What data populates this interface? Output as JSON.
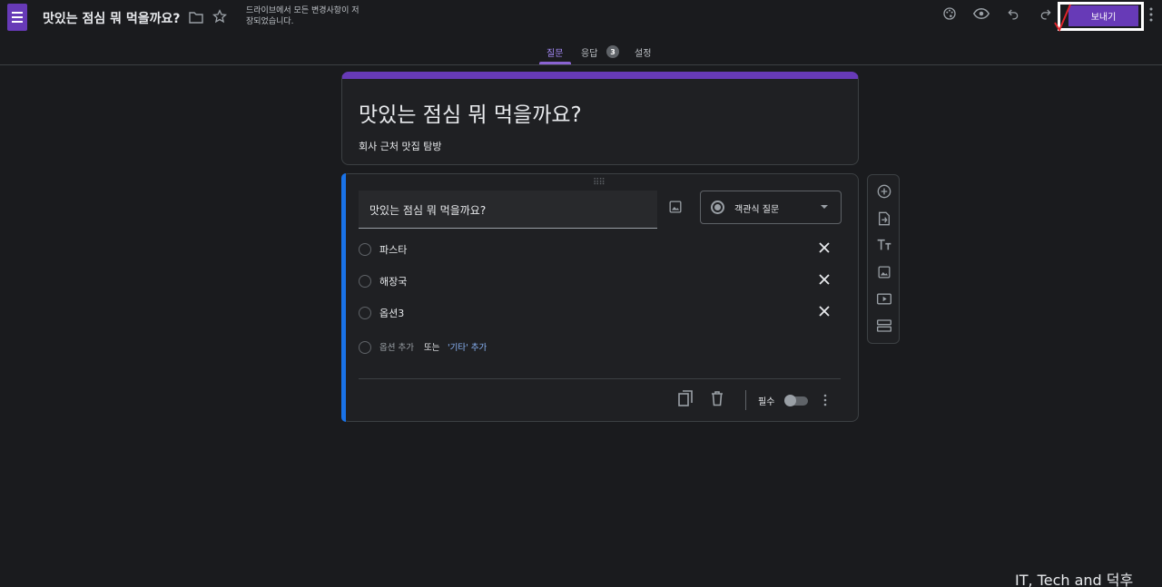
{
  "header": {
    "app_icon": "google-forms-icon",
    "doc_title": "맛있는 점심 뭐 먹을까요?",
    "save_status": "드라이브에서 모든 변경사항이 저장되었습니다.",
    "send_button": "보내기",
    "icons": [
      "folder-icon",
      "star-icon",
      "palette-icon",
      "eye-icon",
      "undo-icon",
      "redo-icon",
      "more-vert-icon"
    ]
  },
  "tabs": [
    {
      "label": "질문",
      "active": true
    },
    {
      "label": "응답",
      "badge": "3"
    },
    {
      "label": "설정"
    }
  ],
  "form": {
    "title": "맛있는 점심 뭐 먹을까요?",
    "description": "회사 근처 맛집 탐방"
  },
  "question": {
    "title": "맛있는 점심 뭐 먹을까요?",
    "type_label": "객관식 질문",
    "options": [
      {
        "label": "파스타"
      },
      {
        "label": "해장국"
      },
      {
        "label": "옵션3"
      }
    ],
    "add_option": "옵션 추가",
    "or_text": "또는",
    "add_other": "'기타' 추가",
    "required_label": "필수",
    "required": false
  },
  "side_toolbar": [
    "add-question-icon",
    "import-questions-icon",
    "add-title-icon",
    "add-image-icon",
    "add-video-icon",
    "add-section-icon"
  ],
  "colors": {
    "background": "#1a1b1e",
    "card": "#1f2023",
    "accent_purple": "#673ab7",
    "accent_blue": "#1a73e8",
    "link_blue": "#8ab4f8"
  },
  "watermark": "IT, Tech and 덕후"
}
